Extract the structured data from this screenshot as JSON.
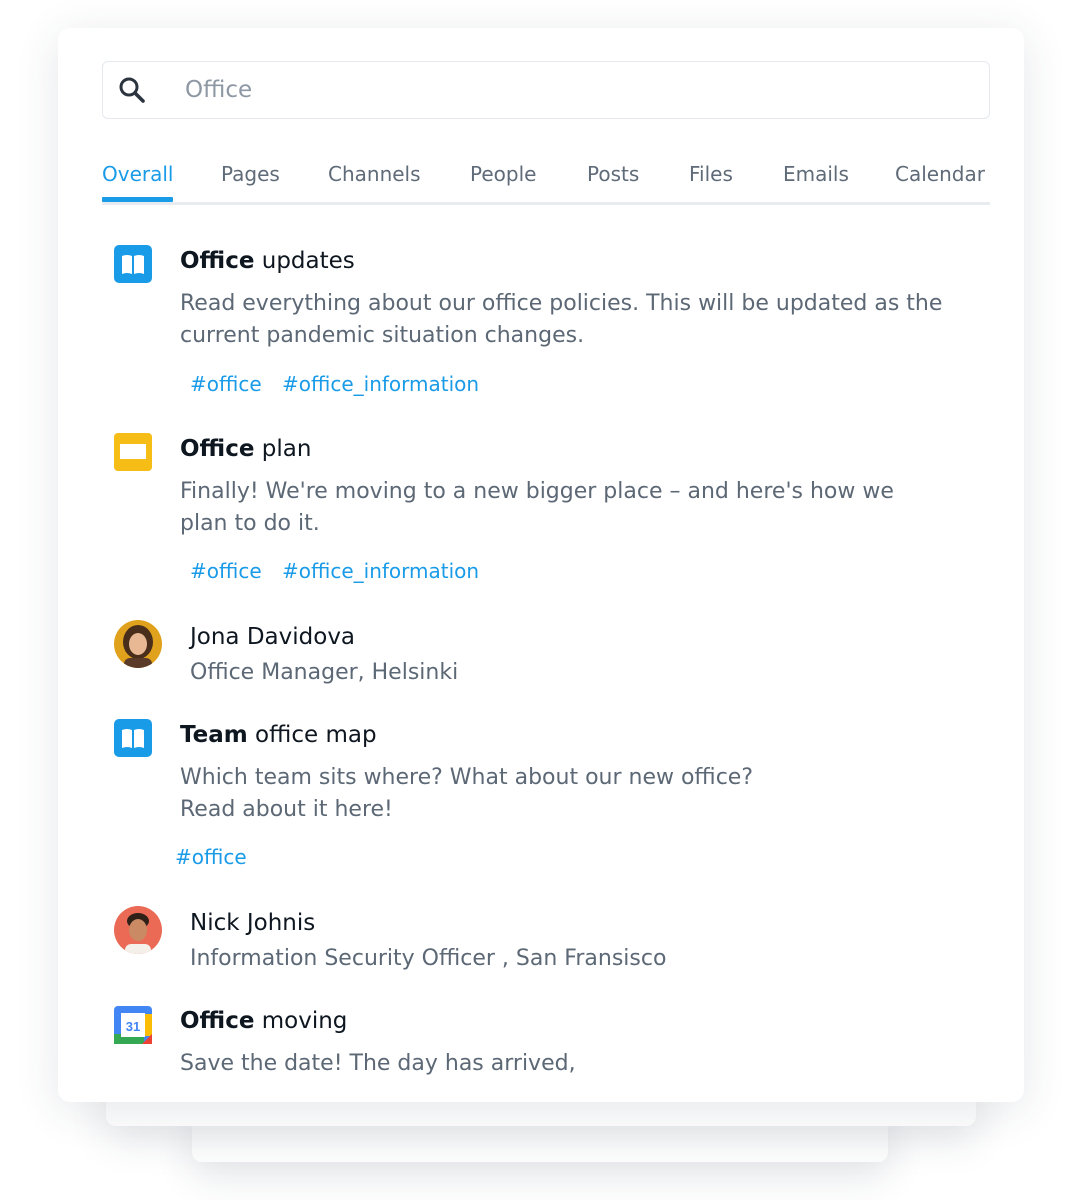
{
  "search": {
    "placeholder": "Office"
  },
  "tabs": [
    {
      "label": "Overall",
      "active": true
    },
    {
      "label": "Pages"
    },
    {
      "label": "Channels"
    },
    {
      "label": "People"
    },
    {
      "label": "Posts"
    },
    {
      "label": "Files"
    },
    {
      "label": "Emails"
    },
    {
      "label": "Calendar"
    }
  ],
  "results": [
    {
      "type": "page",
      "icon": "book-icon",
      "title_bold": "Office",
      "title_rest": " updates",
      "description_lines": [
        "Read everything about our office policies. This will be updated as the",
        "current pandemic situation changes."
      ],
      "tags": [
        "#office",
        "#office_information"
      ]
    },
    {
      "type": "slides",
      "icon": "slides-icon",
      "title_bold": "Office",
      "title_rest": " plan",
      "description_lines": [
        "Finally! We're moving to a new bigger place – and here's how we",
        "plan to do it."
      ],
      "tags": [
        "#office",
        "#office_information"
      ]
    },
    {
      "type": "person",
      "icon": "avatar",
      "name": "Jona Davidova",
      "role": "Office Manager, Helsinki"
    },
    {
      "type": "page",
      "icon": "book-icon",
      "title_bold": "Team",
      "title_rest": " office map",
      "description_lines": [
        "Which team sits where? What about our new office?",
        "Read about it here!"
      ],
      "tags": [
        "#office"
      ]
    },
    {
      "type": "person",
      "icon": "avatar",
      "name": "Nick Johnis",
      "role": "Information Security Officer , San Fransisco"
    },
    {
      "type": "calendar",
      "icon": "calendar-icon",
      "calendar_day": "31",
      "title_bold": "Office",
      "title_rest": " moving",
      "description_lines": [
        "Save the date! The day has arrived,"
      ]
    }
  ],
  "colors": {
    "accent": "#1a9be8",
    "page_icon": "#1a9be8",
    "slides_icon": "#f5bd16",
    "text_primary": "#0e1620",
    "text_secondary": "#5c6875"
  }
}
